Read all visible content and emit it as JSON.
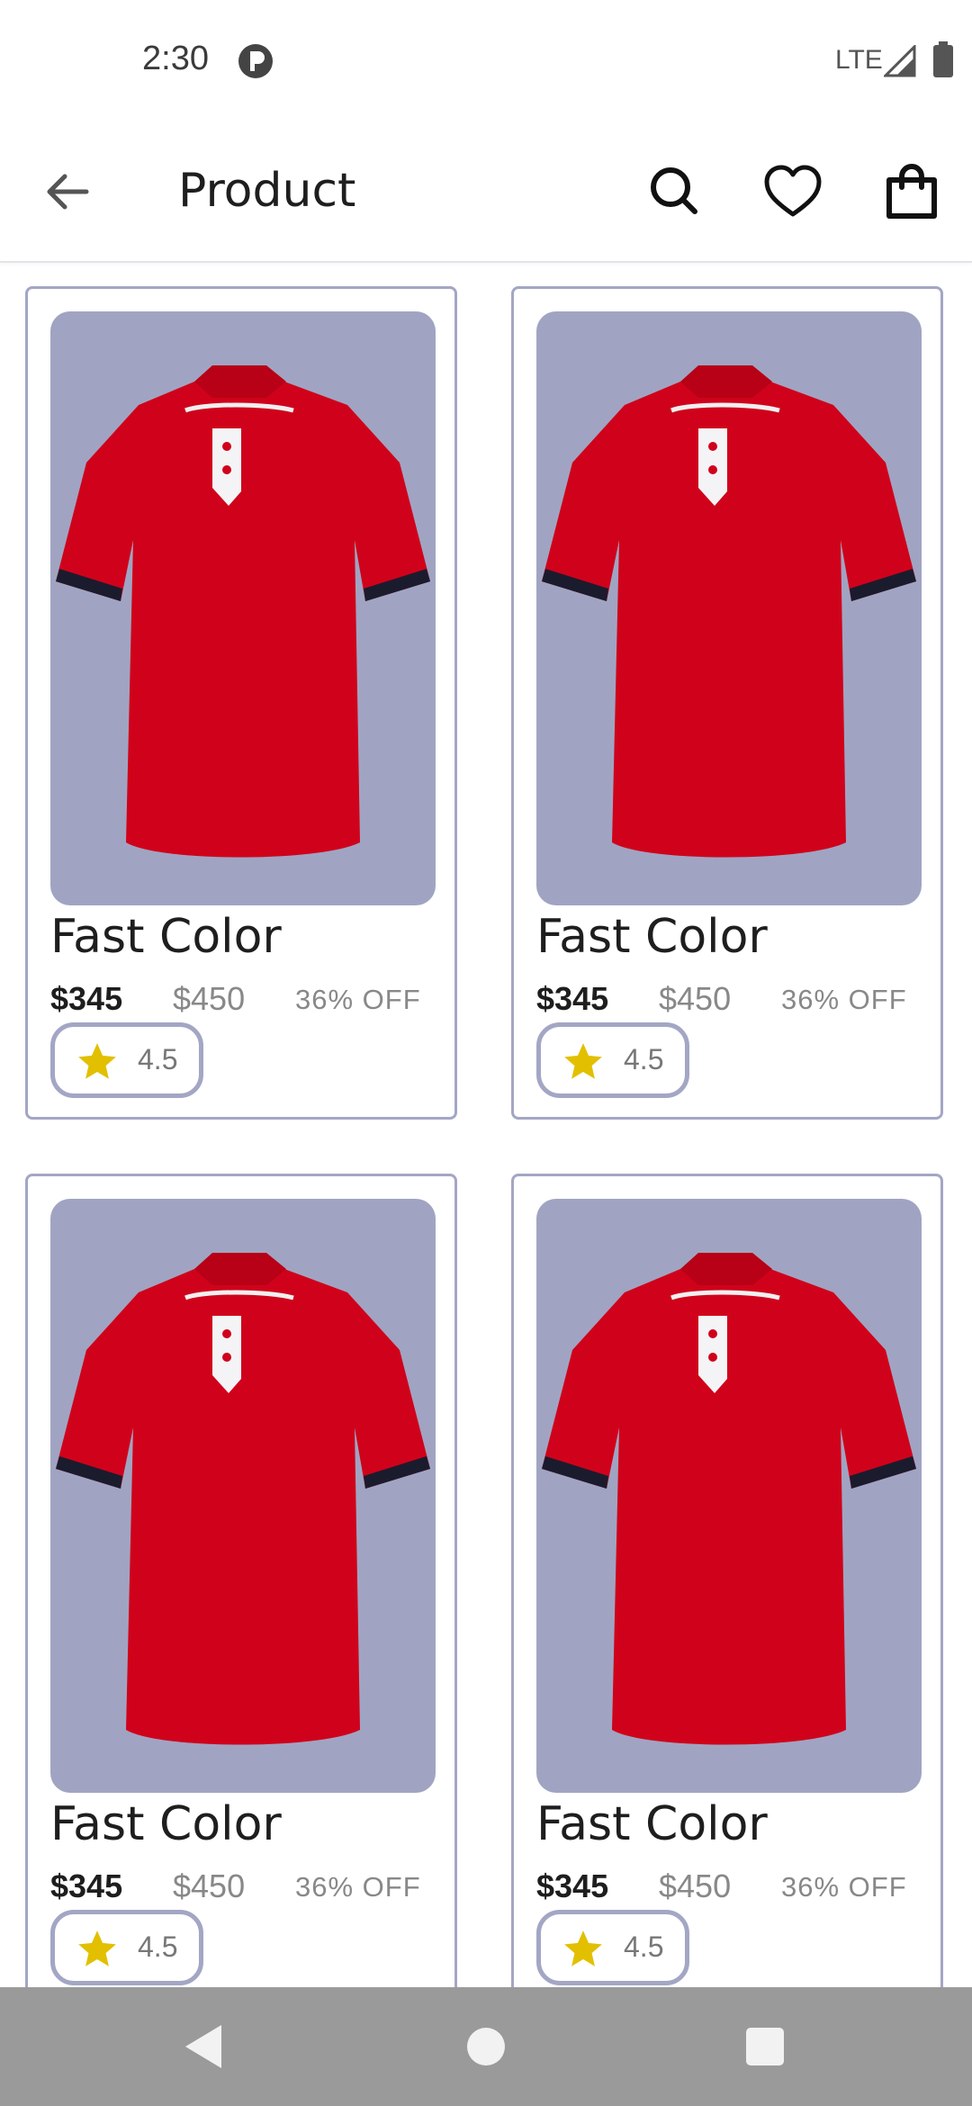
{
  "status_bar": {
    "time": "2:30",
    "network": "LTE"
  },
  "app_bar": {
    "title": "Product",
    "icons": [
      "back-arrow-icon",
      "search-icon",
      "heart-icon",
      "shopping-bag-icon"
    ]
  },
  "products": [
    {
      "title": "Fast Color",
      "price": "$345",
      "old_price": "$450",
      "discount": "36% OFF",
      "rating": "4.5"
    },
    {
      "title": "Fast Color",
      "price": "$345",
      "old_price": "$450",
      "discount": "36% OFF",
      "rating": "4.5"
    },
    {
      "title": "Fast Color",
      "price": "$345",
      "old_price": "$450",
      "discount": "36% OFF",
      "rating": "4.5"
    },
    {
      "title": "Fast Color",
      "price": "$345",
      "old_price": "$450",
      "discount": "36% OFF",
      "rating": "4.5"
    }
  ],
  "nav_bar": {
    "icons": [
      "nav-back-icon",
      "nav-home-icon",
      "nav-recents-icon"
    ]
  },
  "colors": {
    "card_border": "#a3a6c4",
    "image_bg": "#a0a4c2",
    "shirt_red": "#d0021b",
    "star": "#e2c000",
    "nav_bg": "#9a9a9a"
  }
}
